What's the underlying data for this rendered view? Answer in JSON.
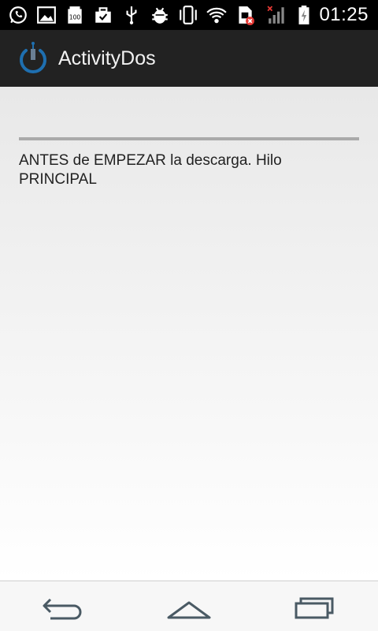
{
  "status_bar": {
    "time": "01:25",
    "icons": [
      "whatsapp-icon",
      "gallery-icon",
      "battery-100-icon",
      "briefcase-icon",
      "usb-icon",
      "android-debug-icon",
      "vibrate-icon",
      "wifi-icon",
      "sim-error-icon",
      "signal-icon",
      "battery-charging-icon"
    ]
  },
  "action_bar": {
    "title": "ActivityDos",
    "icon": "power-app-icon"
  },
  "content": {
    "progress_percent": 0,
    "message": "ANTES de EMPEZAR la descarga. Hilo PRINCIPAL"
  },
  "nav_bar": {
    "buttons": [
      "back-icon",
      "home-icon",
      "recent-apps-icon"
    ]
  },
  "colors": {
    "action_bar_bg": "#222222",
    "progress_track": "#aaaaaa",
    "app_icon_blue": "#1e6fb0"
  }
}
